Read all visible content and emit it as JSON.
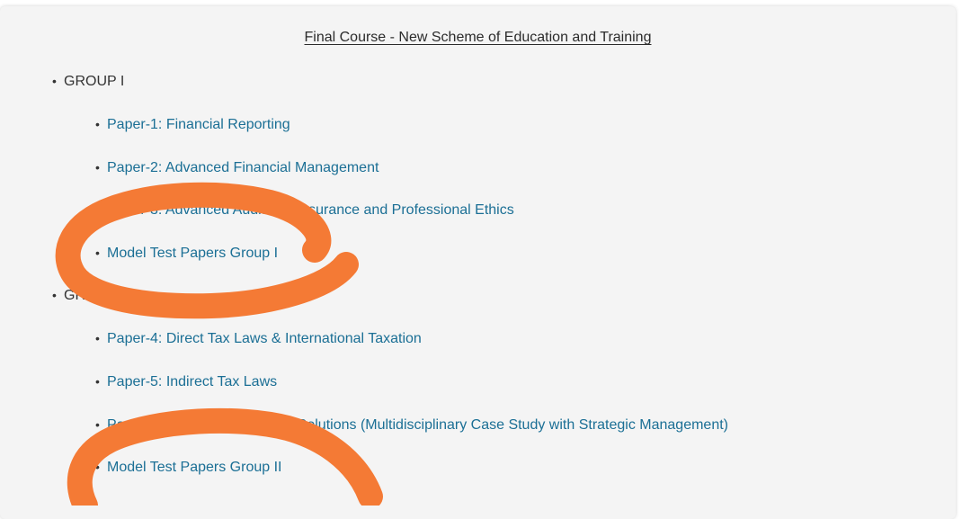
{
  "page": {
    "title": "Final Course - New Scheme of Education and Training"
  },
  "groups": [
    {
      "label": "GROUP I",
      "papers": [
        {
          "label": "Paper-1: Financial Reporting"
        },
        {
          "label": "Paper-2: Advanced Financial Management"
        },
        {
          "label": "Paper-3: Advanced Auditing, Assurance and Professional Ethics"
        },
        {
          "label": "Model Test Papers Group I"
        }
      ]
    },
    {
      "label": "GROUP II",
      "papers": [
        {
          "label": "Paper-4: Direct Tax Laws & International Taxation"
        },
        {
          "label": "Paper-5: Indirect Tax Laws"
        },
        {
          "label": "Paper-6: Integrated Business Solutions (Multidisciplinary Case Study with Strategic Management)"
        },
        {
          "label": "Model Test Papers Group II"
        }
      ]
    }
  ],
  "colors": {
    "link": "#1b6f95",
    "annotation": "#f47a35",
    "background": "#f4f4f4"
  }
}
